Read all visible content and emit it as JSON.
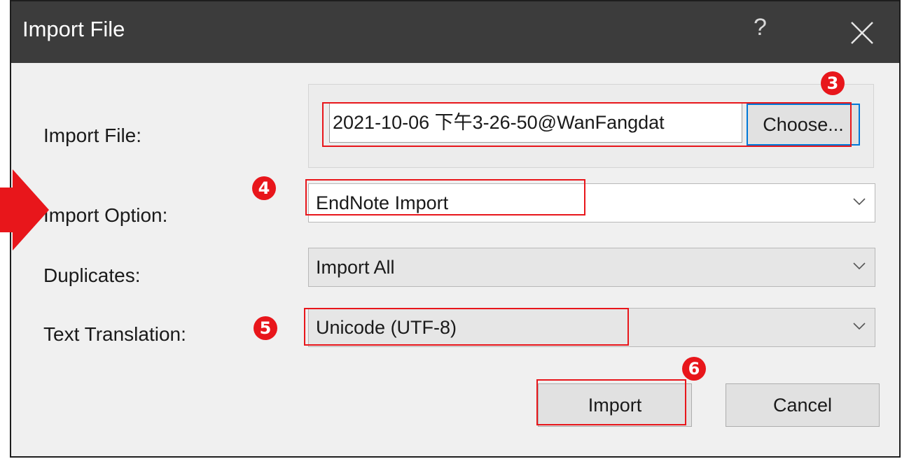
{
  "window": {
    "title": "Import File",
    "help_glyph": "?",
    "close_icon": "close-icon"
  },
  "form": {
    "import_file": {
      "label": "Import File:",
      "value": "2021-10-06 下午3-26-50@WanFangdat",
      "choose_label": "Choose..."
    },
    "import_option": {
      "label": "Import Option:",
      "value": "EndNote Import"
    },
    "duplicates": {
      "label": "Duplicates:",
      "value": "Import All"
    },
    "text_translation": {
      "label": "Text Translation:",
      "value": "Unicode (UTF-8)"
    }
  },
  "buttons": {
    "import_label": "Import",
    "cancel_label": "Cancel"
  },
  "annotations": {
    "step3": "3",
    "step4": "4",
    "step5": "5",
    "step6": "6",
    "color": "#e8161b"
  },
  "colors": {
    "titlebar": "#3c3c3c",
    "dialog_bg": "#f0f0f0",
    "focus_border": "#0078d7"
  }
}
